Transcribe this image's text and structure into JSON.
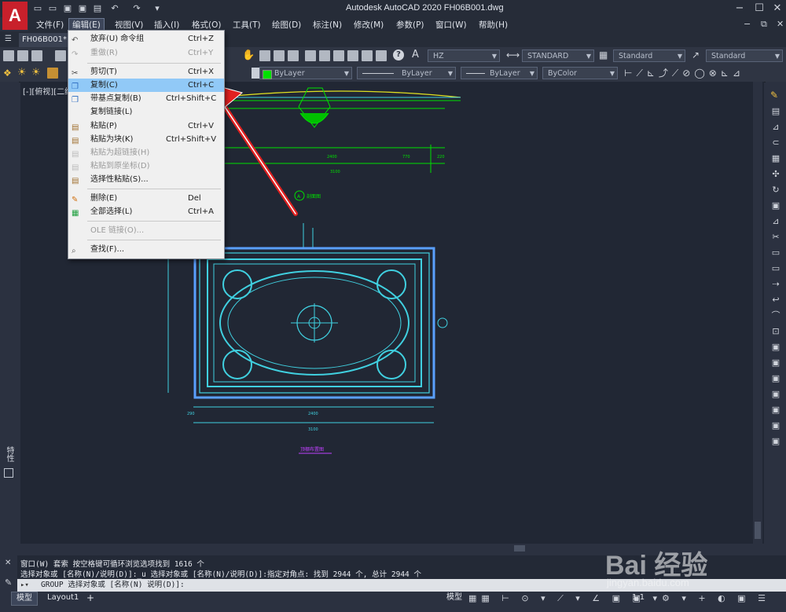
{
  "window": {
    "title": "Autodesk AutoCAD 2020    FH06B001.dwg",
    "app_icon_letter": "A"
  },
  "menubar": {
    "items": [
      "文件(F)",
      "编辑(E)",
      "视图(V)",
      "插入(I)",
      "格式(O)",
      "工具(T)",
      "绘图(D)",
      "标注(N)",
      "修改(M)",
      "参数(P)",
      "窗口(W)",
      "帮助(H)"
    ],
    "active_index": 1
  },
  "document_tab": {
    "label": "FH06B001*"
  },
  "toolbar": {
    "text_style": "HZ",
    "dim_style": "STANDARD",
    "table_style": "Standard",
    "mleader_style": "Standard",
    "color": "ByLayer",
    "linetype": "ByLayer",
    "lineweight": "ByLayer",
    "plot_style": "ByColor",
    "accent_color": "#00e000"
  },
  "viewport": {
    "label": "[-][俯视][二维"
  },
  "edit_menu": {
    "items": [
      {
        "label": "放弃(U) 命令组",
        "shortcut": "Ctrl+Z",
        "enabled": true,
        "icon": "undo-icon"
      },
      {
        "label": "重做(R)",
        "shortcut": "Ctrl+Y",
        "enabled": false,
        "icon": "redo-icon"
      },
      {
        "label": "剪切(T)",
        "shortcut": "Ctrl+X",
        "enabled": true,
        "icon": "cut-icon"
      },
      {
        "label": "复制(C)",
        "shortcut": "Ctrl+C",
        "enabled": true,
        "icon": "copy-icon",
        "highlighted": true
      },
      {
        "label": "带基点复制(B)",
        "shortcut": "Ctrl+Shift+C",
        "enabled": true,
        "icon": "copy-basepoint-icon"
      },
      {
        "label": "复制链接(L)",
        "shortcut": "",
        "enabled": true,
        "icon": "copy-link-icon"
      },
      {
        "label": "粘贴(P)",
        "shortcut": "Ctrl+V",
        "enabled": true,
        "icon": "paste-icon"
      },
      {
        "label": "粘贴为块(K)",
        "shortcut": "Ctrl+Shift+V",
        "enabled": true,
        "icon": "paste-block-icon"
      },
      {
        "label": "粘贴为超链接(H)",
        "shortcut": "",
        "enabled": false,
        "icon": "paste-hyperlink-icon"
      },
      {
        "label": "粘贴到原坐标(D)",
        "shortcut": "",
        "enabled": false,
        "icon": "paste-original-icon"
      },
      {
        "label": "选择性粘贴(S)...",
        "shortcut": "",
        "enabled": true,
        "icon": "paste-special-icon"
      },
      {
        "label": "删除(E)",
        "shortcut": "Del",
        "enabled": true,
        "icon": "erase-icon"
      },
      {
        "label": "全部选择(L)",
        "shortcut": "Ctrl+A",
        "enabled": true,
        "icon": "select-all-icon"
      },
      {
        "label": "OLE 链接(O)...",
        "shortcut": "",
        "enabled": false,
        "icon": ""
      },
      {
        "label": "查找(F)...",
        "shortcut": "",
        "enabled": true,
        "icon": "find-icon"
      }
    ]
  },
  "drawing": {
    "elevation_title": "剖面图",
    "elevation_tag": "A",
    "plan_title": "顶棚布置图",
    "dim_top_mid": "2400",
    "dim_top_left": "220",
    "dim_top_right": "770",
    "dim_top_total": "3100",
    "dim_plan_mid": "2400",
    "dim_plan_total": "3100",
    "dim_plan_side": "290"
  },
  "command_line": {
    "history_1": "窗口(W) 套索  按空格键可循环浏览选项找到 1616 个",
    "history_2": "选择对象或 [名称(N)/说明(D)]:_u 选择对象或 [名称(N)/说明(D)]:指定对角点: 找到 2944 个, 总计 2944 个",
    "prompt": "GROUP 选择对象或 [名称(N) 说明(D)]:"
  },
  "status": {
    "tab_model": "模型",
    "tab_layout1": "Layout1",
    "model_label": "模型",
    "scale": "1:1"
  },
  "side_panel": {
    "label": "特性"
  },
  "watermark": {
    "text": "Bai 经验",
    "url": "jingyan.baidu.com"
  }
}
